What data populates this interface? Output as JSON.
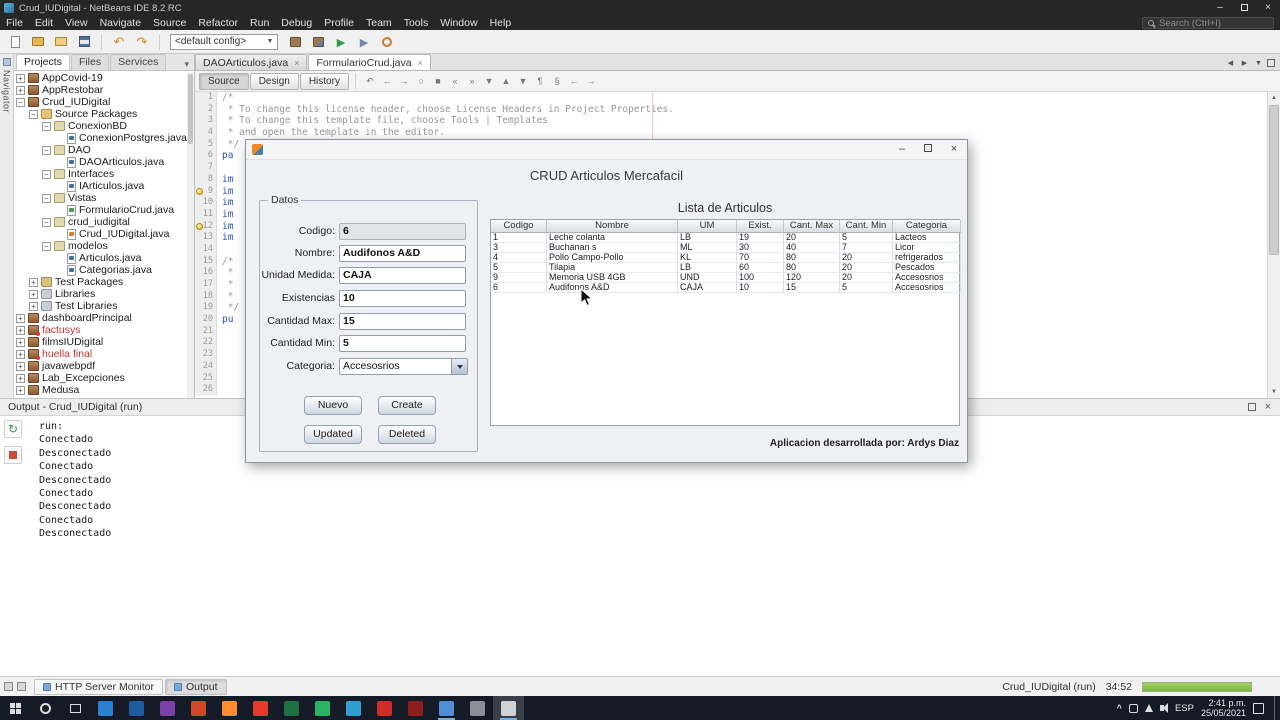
{
  "colors": {
    "accent_blue": "#3d6fb4",
    "run_green": "#2f9e44",
    "error_red": "#c43535",
    "progress_green": "#7bb33e",
    "taskbar_bg": "#141b26",
    "titlebar_bg": "#262626"
  },
  "titlebar": {
    "title": "Crud_IUDigital - NetBeans IDE 8.2 RC"
  },
  "menubar": {
    "items": [
      "File",
      "Edit",
      "View",
      "Navigate",
      "Source",
      "Refactor",
      "Run",
      "Debug",
      "Profile",
      "Team",
      "Tools",
      "Window",
      "Help"
    ],
    "search_placeholder": "Search (Ctrl+I)"
  },
  "toolbar": {
    "config_value": "<default config>",
    "icons_g1": [
      "new-file",
      "new-project",
      "open-project",
      "save-all"
    ],
    "icons_g2": [
      "undo",
      "redo"
    ],
    "icons_g3": [
      "build",
      "clean-build",
      "run",
      "debug",
      "profile"
    ]
  },
  "left_rail": {
    "label": "Navigator"
  },
  "projects_panel": {
    "tabs": [
      {
        "label": "Projects",
        "active": true
      },
      {
        "label": "Files",
        "active": false
      },
      {
        "label": "Services",
        "active": false
      }
    ],
    "tree": [
      {
        "label": "AppCovid-19",
        "level": 0,
        "icon": "project",
        "toggle": "collapsed"
      },
      {
        "label": "AppRestobar",
        "level": 0,
        "icon": "project",
        "toggle": "collapsed"
      },
      {
        "label": "Crud_IUDigital",
        "level": 0,
        "icon": "project",
        "toggle": "expanded"
      },
      {
        "label": "Source Packages",
        "level": 1,
        "icon": "sources",
        "toggle": "expanded"
      },
      {
        "label": "ConexionBD",
        "level": 2,
        "icon": "package",
        "toggle": "expanded"
      },
      {
        "label": "ConexionPostgres.java",
        "level": 3,
        "icon": "java",
        "toggle": "none"
      },
      {
        "label": "DAO",
        "level": 2,
        "icon": "package",
        "toggle": "expanded"
      },
      {
        "label": "DAOArticulos.java",
        "level": 3,
        "icon": "java",
        "toggle": "none"
      },
      {
        "label": "Interfaces",
        "level": 2,
        "icon": "package",
        "toggle": "expanded"
      },
      {
        "label": "IArticulos.java",
        "level": 3,
        "icon": "java",
        "toggle": "none"
      },
      {
        "label": "Vistas",
        "level": 2,
        "icon": "package",
        "toggle": "expanded"
      },
      {
        "label": "FormularioCrud.java",
        "level": 3,
        "icon": "form",
        "toggle": "none"
      },
      {
        "label": "crud_iudigital",
        "level": 2,
        "icon": "package",
        "toggle": "expanded"
      },
      {
        "label": "Crud_IUDigital.java",
        "level": 3,
        "icon": "java-main",
        "toggle": "none"
      },
      {
        "label": "modelos",
        "level": 2,
        "icon": "package",
        "toggle": "expanded"
      },
      {
        "label": "Articulos.java",
        "level": 3,
        "icon": "java",
        "toggle": "none"
      },
      {
        "label": "Categorias.java",
        "level": 3,
        "icon": "java",
        "toggle": "none"
      },
      {
        "label": "Test Packages",
        "level": 1,
        "icon": "folder",
        "toggle": "collapsed"
      },
      {
        "label": "Libraries",
        "level": 1,
        "icon": "libraries",
        "toggle": "collapsed"
      },
      {
        "label": "Test Libraries",
        "level": 1,
        "icon": "libraries",
        "toggle": "collapsed"
      },
      {
        "label": "dashboardPrincipal",
        "level": 0,
        "icon": "project",
        "toggle": "collapsed"
      },
      {
        "label": "factusys",
        "level": 0,
        "icon": "project-broken",
        "toggle": "collapsed",
        "error": true
      },
      {
        "label": "filmsIUDigital",
        "level": 0,
        "icon": "project",
        "toggle": "collapsed"
      },
      {
        "label": "huella final",
        "level": 0,
        "icon": "project-broken",
        "toggle": "collapsed",
        "error": true
      },
      {
        "label": "javawebpdf",
        "level": 0,
        "icon": "project",
        "toggle": "collapsed"
      },
      {
        "label": "Lab_Excepciones",
        "level": 0,
        "icon": "project",
        "toggle": "collapsed"
      },
      {
        "label": "Medusa",
        "level": 0,
        "icon": "project",
        "toggle": "collapsed"
      }
    ]
  },
  "editor": {
    "tabs": [
      {
        "label": "DAOArticulos.java",
        "active": false
      },
      {
        "label": "FormularioCrud.java",
        "active": true
      }
    ],
    "view_buttons": [
      {
        "label": "Source",
        "active": true
      },
      {
        "label": "Design",
        "active": false
      },
      {
        "label": "History",
        "active": false
      }
    ],
    "toolbar_icons": [
      "last-edit",
      "back",
      "forward",
      "find-selection",
      "highlight",
      "prev-bookmark",
      "next-bookmark",
      "toggle-bookmark",
      "prev-error",
      "next-error",
      "comment",
      "uncomment",
      "indent-left",
      "indent-right"
    ],
    "lines": [
      {
        "n": 1,
        "text": "/*",
        "type": "comment"
      },
      {
        "n": 2,
        "text": " * To change this license header, choose License Headers in Project Properties.",
        "type": "comment"
      },
      {
        "n": 3,
        "text": " * To change this template file, choose Tools | Templates",
        "type": "comment"
      },
      {
        "n": 4,
        "text": " * and open the template in the editor.",
        "type": "comment"
      },
      {
        "n": 5,
        "text": " */",
        "type": "comment"
      },
      {
        "n": 6,
        "text": "pa",
        "type": "keyword"
      },
      {
        "n": 7,
        "text": "",
        "type": "plain"
      },
      {
        "n": 8,
        "text": "im",
        "type": "keyword"
      },
      {
        "n": 9,
        "text": "im",
        "type": "keyword",
        "bulb": true
      },
      {
        "n": 10,
        "text": "im",
        "type": "keyword"
      },
      {
        "n": 11,
        "text": "im",
        "type": "keyword"
      },
      {
        "n": 12,
        "text": "im",
        "type": "keyword",
        "bulb": true
      },
      {
        "n": 13,
        "text": "im",
        "type": "keyword"
      },
      {
        "n": 14,
        "text": "",
        "type": "plain"
      },
      {
        "n": 15,
        "text": "/*",
        "type": "comment"
      },
      {
        "n": 16,
        "text": " *",
        "type": "comment"
      },
      {
        "n": 17,
        "text": " *",
        "type": "comment"
      },
      {
        "n": 18,
        "text": " *",
        "type": "comment"
      },
      {
        "n": 19,
        "text": " */",
        "type": "comment"
      },
      {
        "n": 20,
        "text": "pu",
        "type": "keyword"
      },
      {
        "n": 21,
        "text": "",
        "type": "plain"
      },
      {
        "n": 22,
        "text": "",
        "type": "plain"
      },
      {
        "n": 23,
        "text": "",
        "type": "plain"
      },
      {
        "n": 24,
        "text": "",
        "type": "plain"
      },
      {
        "n": 25,
        "text": "",
        "type": "plain"
      },
      {
        "n": 26,
        "text": "",
        "type": "plain"
      }
    ]
  },
  "output": {
    "title": "Output - Crud_IUDigital (run)",
    "lines": [
      "run:",
      "Conectado",
      "Desconectado",
      "Conectado",
      "Desconectado",
      "Conectado",
      "Desconectado",
      "Conectado",
      "Desconectado"
    ]
  },
  "statusbar": {
    "tabs": [
      {
        "label": "HTTP Server Monitor",
        "active": false
      },
      {
        "label": "Output",
        "active": true
      }
    ],
    "task_label": "Crud_IUDigital (run)",
    "timer": "34:52"
  },
  "taskbar": {
    "apps": [
      {
        "color": "#2a81cf",
        "running": false,
        "active": false
      },
      {
        "color": "#1d5aa0",
        "running": false,
        "active": false
      },
      {
        "color": "#7a3fa8",
        "running": false,
        "active": false
      },
      {
        "color": "#d24726",
        "running": false,
        "active": false
      },
      {
        "color": "#ff8c2e",
        "running": false,
        "active": false
      },
      {
        "color": "#e23b2e",
        "running": false,
        "active": false
      },
      {
        "color": "#1f7145",
        "running": false,
        "active": false
      },
      {
        "color": "#28b463",
        "running": false,
        "active": false
      },
      {
        "color": "#2e9fd0",
        "running": false,
        "active": false
      },
      {
        "color": "#cf2b27",
        "running": false,
        "active": false
      },
      {
        "color": "#8f1d1d",
        "running": false,
        "active": false
      },
      {
        "color": "#4f8fd6",
        "running": true,
        "active": false
      },
      {
        "color": "#8a8f98",
        "running": false,
        "active": false
      },
      {
        "color": "#cfd3d8",
        "running": true,
        "active": true
      }
    ],
    "tray": {
      "lang": "ESP",
      "time": "2:41 p.m.",
      "date": "25/05/2021"
    }
  },
  "dialog": {
    "title": "CRUD Articulos Mercafacil",
    "datos_label": "Datos",
    "fields": [
      {
        "label": "Codigo:",
        "value": "6",
        "type": "disabled"
      },
      {
        "label": "Nombre:",
        "value": "Audifonos A&D",
        "type": "text"
      },
      {
        "label": "Unidad Medida:",
        "value": "CAJA",
        "type": "text"
      },
      {
        "label": "Existencias",
        "value": "10",
        "type": "text"
      },
      {
        "label": "Cantidad Max:",
        "value": "15",
        "type": "text"
      },
      {
        "label": "Cantidad Min:",
        "value": "5",
        "type": "text"
      },
      {
        "label": "Categoria:",
        "value": "Accesosrios",
        "type": "combo"
      }
    ],
    "buttons": [
      "Nuevo",
      "Create",
      "Updated",
      "Deleted"
    ],
    "lista_label": "Lista de Articulos",
    "table": {
      "columns": [
        "Codigo",
        "Nombre",
        "UM",
        "Exist.",
        "Cant. Max",
        "Cant. Min",
        "Categoria"
      ],
      "rows": [
        [
          "1",
          "Leche colanta",
          "LB",
          "19",
          "20",
          "5",
          "Lacteos"
        ],
        [
          "3",
          "Buchanan s",
          "ML",
          "30",
          "40",
          "7",
          "Licor"
        ],
        [
          "4",
          "Pollo Campo-Pollo",
          "KL",
          "70",
          "80",
          "20",
          "refrigerados"
        ],
        [
          "5",
          "Tilapia",
          "LB",
          "60",
          "80",
          "20",
          "Pescados"
        ],
        [
          "9",
          "Memoria USB 4GB",
          "UND",
          "100",
          "120",
          "20",
          "Accesosrios"
        ],
        [
          "6",
          "Audifonos A&D",
          "CAJA",
          "10",
          "15",
          "5",
          "Accesosrios"
        ]
      ]
    },
    "credit": "Aplicacion desarrollada por: Ardys Diaz"
  }
}
